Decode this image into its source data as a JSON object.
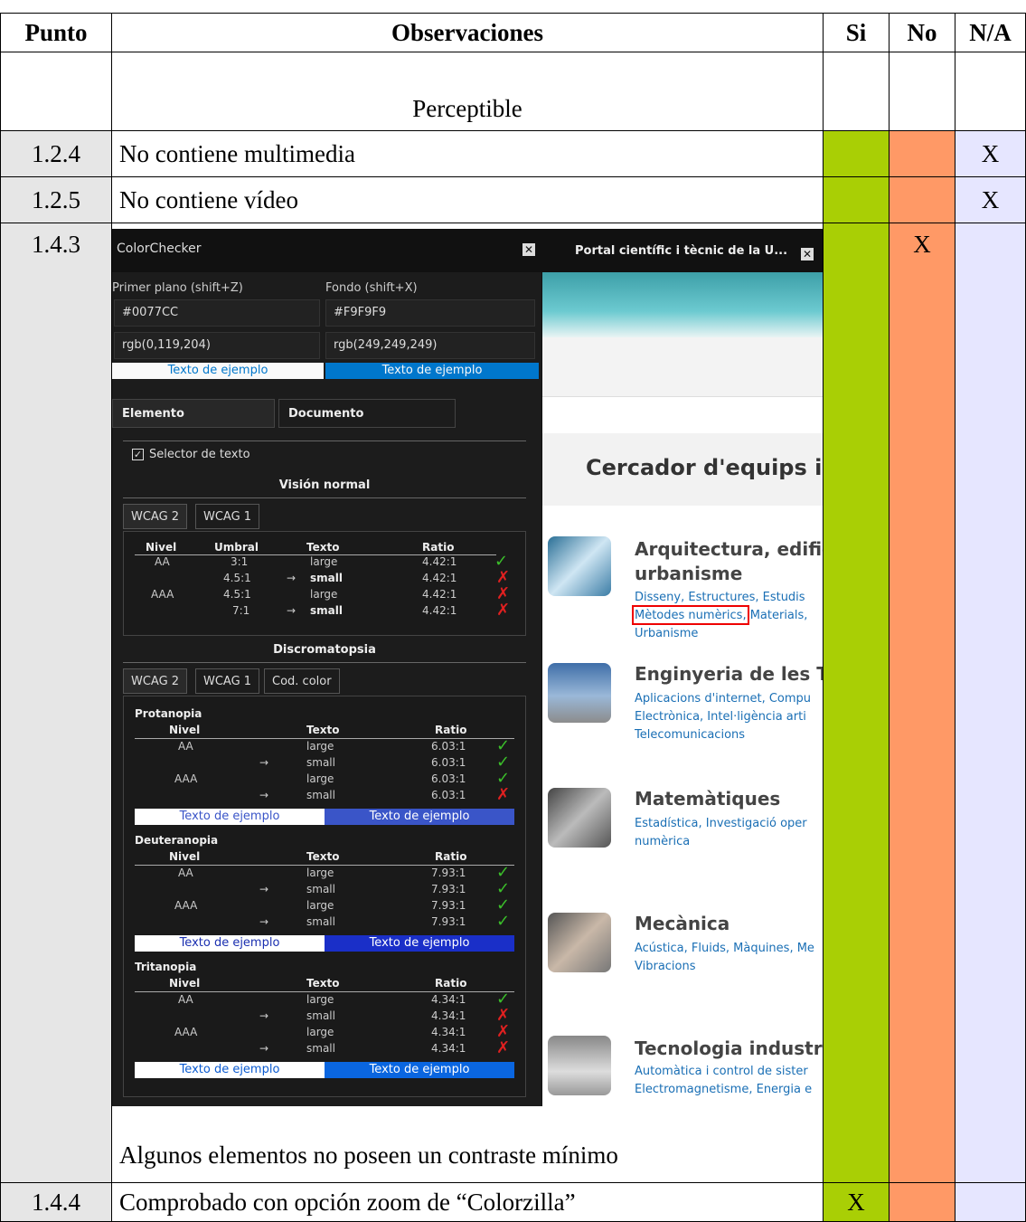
{
  "colors": {
    "si": "#a9cf05",
    "no": "#ff9966",
    "na": "#e6e6ff",
    "punto": "#e6e6e6"
  },
  "table": {
    "headers": [
      "Punto",
      "Observaciones",
      "Si",
      "No",
      "N/A"
    ],
    "section": "Perceptible",
    "rows": [
      {
        "punto": "1.2.4",
        "obs": "No contiene multimedia",
        "si": "",
        "no": "",
        "na": "X"
      },
      {
        "punto": "1.2.5",
        "obs": "No contiene vídeo",
        "si": "",
        "no": "",
        "na": "X"
      },
      {
        "punto": "1.4.3",
        "obs": "Algunos elementos no poseen un contraste mínimo",
        "si": "",
        "no": "X",
        "na": ""
      },
      {
        "punto": "1.4.4",
        "obs": "Comprobado con opción zoom de “Colorzilla”",
        "si": "X",
        "no": "",
        "na": ""
      }
    ]
  },
  "screenshot": {
    "colorchecker": {
      "title": "ColorChecker",
      "fg_label": "Primer plano (shift+Z)",
      "bg_label": "Fondo (shift+X)",
      "fg_hex": "#0077CC",
      "bg_hex": "#F9F9F9",
      "fg_rgb": "rgb(0,119,204)",
      "bg_rgb": "rgb(249,249,249)",
      "sample": "Texto de ejemplo",
      "tab_elemento": "Elemento",
      "tab_documento": "Documento",
      "selector": "Selector de texto",
      "vision_normal": "Visión normal",
      "wcag2": "WCAG 2",
      "wcag1": "WCAG 1",
      "cod_color": "Cod. color",
      "cols": {
        "nivel": "Nivel",
        "umbral": "Umbral",
        "texto": "Texto",
        "ratio": "Ratio"
      },
      "normal_rows": [
        {
          "nivel": "AA",
          "umbral": "3:1",
          "texto": "large",
          "ratio": "4.42:1",
          "pass": true
        },
        {
          "nivel": "",
          "umbral": "4.5:1",
          "texto": "small",
          "ratio": "4.42:1",
          "pass": false
        },
        {
          "nivel": "AAA",
          "umbral": "4.5:1",
          "texto": "large",
          "ratio": "4.42:1",
          "pass": false
        },
        {
          "nivel": "",
          "umbral": "7:1",
          "texto": "small",
          "ratio": "4.42:1",
          "pass": false
        }
      ],
      "discromatopsia": "Discromatopsia",
      "groups": [
        {
          "name": "Protanopia",
          "ratio": "6.03:1",
          "pass": [
            true,
            true,
            true,
            false
          ]
        },
        {
          "name": "Deuteranopia",
          "ratio": "7.93:1",
          "pass": [
            true,
            true,
            true,
            true
          ]
        },
        {
          "name": "Tritanopia",
          "ratio": "4.34:1",
          "pass": [
            true,
            false,
            false,
            false
          ]
        }
      ],
      "levels": [
        "AA",
        "",
        "AAA",
        ""
      ],
      "textos": [
        "large",
        "small",
        "large",
        "small"
      ]
    },
    "browser": {
      "tab_title": "Portal científic i tècnic de la U...",
      "heading": "Cercador d'equips i",
      "items": [
        {
          "title": "Arquitectura, edifica",
          "title2": "urbanisme",
          "links": [
            "Disseny, Estructures, Estudis",
            "Mètodes numèrics, Materials,",
            "Urbanisme"
          ]
        },
        {
          "title": "Enginyeria de les Tl",
          "links": [
            "Aplicacions d'internet, Compu",
            "Electrònica, Intel·ligència arti",
            "Telecomunicacions"
          ]
        },
        {
          "title": "Matemàtiques",
          "links": [
            "Estadística, Investigació oper",
            "numèrica"
          ]
        },
        {
          "title": "Mecànica",
          "links": [
            "Acústica, Fluids, Màquines, Me",
            "Vibracions"
          ]
        },
        {
          "title": "Tecnologia industri",
          "links": [
            "Automàtica i control de sister",
            "Electromagnetisme, Energia e"
          ]
        }
      ]
    }
  }
}
